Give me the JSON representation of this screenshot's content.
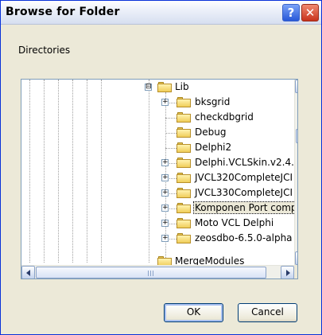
{
  "window": {
    "title": "Browse for Folder"
  },
  "titlebar": {
    "help_label": "?",
    "close_label": "✕"
  },
  "label": "Directories",
  "tree": {
    "items": [
      {
        "label": "Lib",
        "expander": "⊟",
        "selected": false
      },
      {
        "label": "bksgrid",
        "expander": "+",
        "selected": false
      },
      {
        "label": "checkdbgrid",
        "expander": "",
        "selected": false
      },
      {
        "label": "Debug",
        "expander": "",
        "selected": false
      },
      {
        "label": "Delphi2",
        "expander": "",
        "selected": false
      },
      {
        "label": "Delphi.VCLSkin.v2.4.",
        "expander": "+",
        "selected": false
      },
      {
        "label": "JVCL320CompleteJCI",
        "expander": "+",
        "selected": false
      },
      {
        "label": "JVCL330CompleteJCI",
        "expander": "+",
        "selected": false
      },
      {
        "label": "Komponen Port comp",
        "expander": "+",
        "selected": true
      },
      {
        "label": "Moto VCL Delphi",
        "expander": "+",
        "selected": false
      },
      {
        "label": "zeosdbo-6.5.0-alpha",
        "expander": "+",
        "selected": false
      },
      {
        "label": "MergeModules",
        "expander": "",
        "selected": false
      }
    ]
  },
  "buttons": {
    "ok": "OK",
    "cancel": "Cancel"
  },
  "colors": {
    "titlebar": "#d6def0",
    "close": "#c8331c",
    "help": "#2858d8",
    "dialog_bg": "#ece9d8",
    "border": "#7f9db9"
  },
  "icons": {
    "help": "question-icon",
    "close": "close-x-icon",
    "folder": "folder-icon",
    "expand": "plus-box-icon",
    "collapse": "minus-box-icon"
  }
}
